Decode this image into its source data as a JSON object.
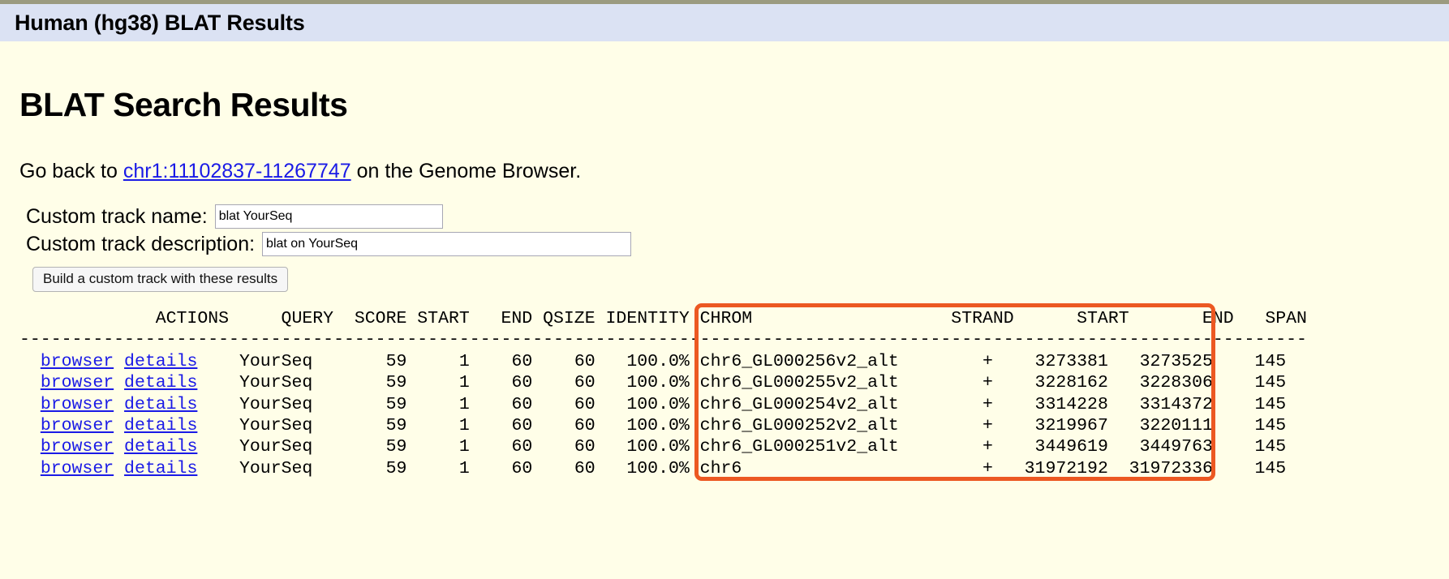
{
  "window": {
    "title_bar": "Human (hg38) BLAT Results"
  },
  "page": {
    "heading": "BLAT Search Results",
    "goback_prefix": "Go back to ",
    "goback_link": "chr1:11102837-11267747",
    "goback_suffix": " on the Genome Browser."
  },
  "form": {
    "track_name_label": "Custom track name:",
    "track_name_value": "blat YourSeq",
    "track_name_placeholder": "",
    "track_desc_label": "Custom track description:",
    "track_desc_value": "blat on YourSeq",
    "track_desc_placeholder": "",
    "build_button": "Build a custom track with these results"
  },
  "table": {
    "columns": [
      "ACTIONS",
      "QUERY",
      "SCORE",
      "START",
      "END",
      "QSIZE",
      "IDENTITY",
      "CHROM",
      "STRAND",
      "START",
      "END",
      "SPAN"
    ],
    "separator_char": "-",
    "action_links": [
      "browser",
      "details"
    ],
    "rows": [
      {
        "query": "YourSeq",
        "score": "59",
        "start": "1",
        "end": "60",
        "qsize": "60",
        "identity": "100.0%",
        "chrom": "chr6_GL000256v2_alt",
        "strand": "+",
        "chrom_start": "3273381",
        "chrom_end": "3273525",
        "span": "145"
      },
      {
        "query": "YourSeq",
        "score": "59",
        "start": "1",
        "end": "60",
        "qsize": "60",
        "identity": "100.0%",
        "chrom": "chr6_GL000255v2_alt",
        "strand": "+",
        "chrom_start": "3228162",
        "chrom_end": "3228306",
        "span": "145"
      },
      {
        "query": "YourSeq",
        "score": "59",
        "start": "1",
        "end": "60",
        "qsize": "60",
        "identity": "100.0%",
        "chrom": "chr6_GL000254v2_alt",
        "strand": "+",
        "chrom_start": "3314228",
        "chrom_end": "3314372",
        "span": "145"
      },
      {
        "query": "YourSeq",
        "score": "59",
        "start": "1",
        "end": "60",
        "qsize": "60",
        "identity": "100.0%",
        "chrom": "chr6_GL000252v2_alt",
        "strand": "+",
        "chrom_start": "3219967",
        "chrom_end": "3220111",
        "span": "145"
      },
      {
        "query": "YourSeq",
        "score": "59",
        "start": "1",
        "end": "60",
        "qsize": "60",
        "identity": "100.0%",
        "chrom": "chr6_GL000251v2_alt",
        "strand": "+",
        "chrom_start": "3449619",
        "chrom_end": "3449763",
        "span": "145"
      },
      {
        "query": "YourSeq",
        "score": "59",
        "start": "1",
        "end": "60",
        "qsize": "60",
        "identity": "100.0%",
        "chrom": "chr6",
        "strand": "+",
        "chrom_start": "31972192",
        "chrom_end": "31972336",
        "span": "145"
      }
    ]
  },
  "annotation": {
    "highlight_color": "#ec5822",
    "highlight_region": "chrom-strand-start-end-columns"
  },
  "colors": {
    "page_background": "#fffee8",
    "title_bar_background": "#dbe2f3",
    "link": "#1a1ae6",
    "top_rule": "#9b9b80"
  }
}
